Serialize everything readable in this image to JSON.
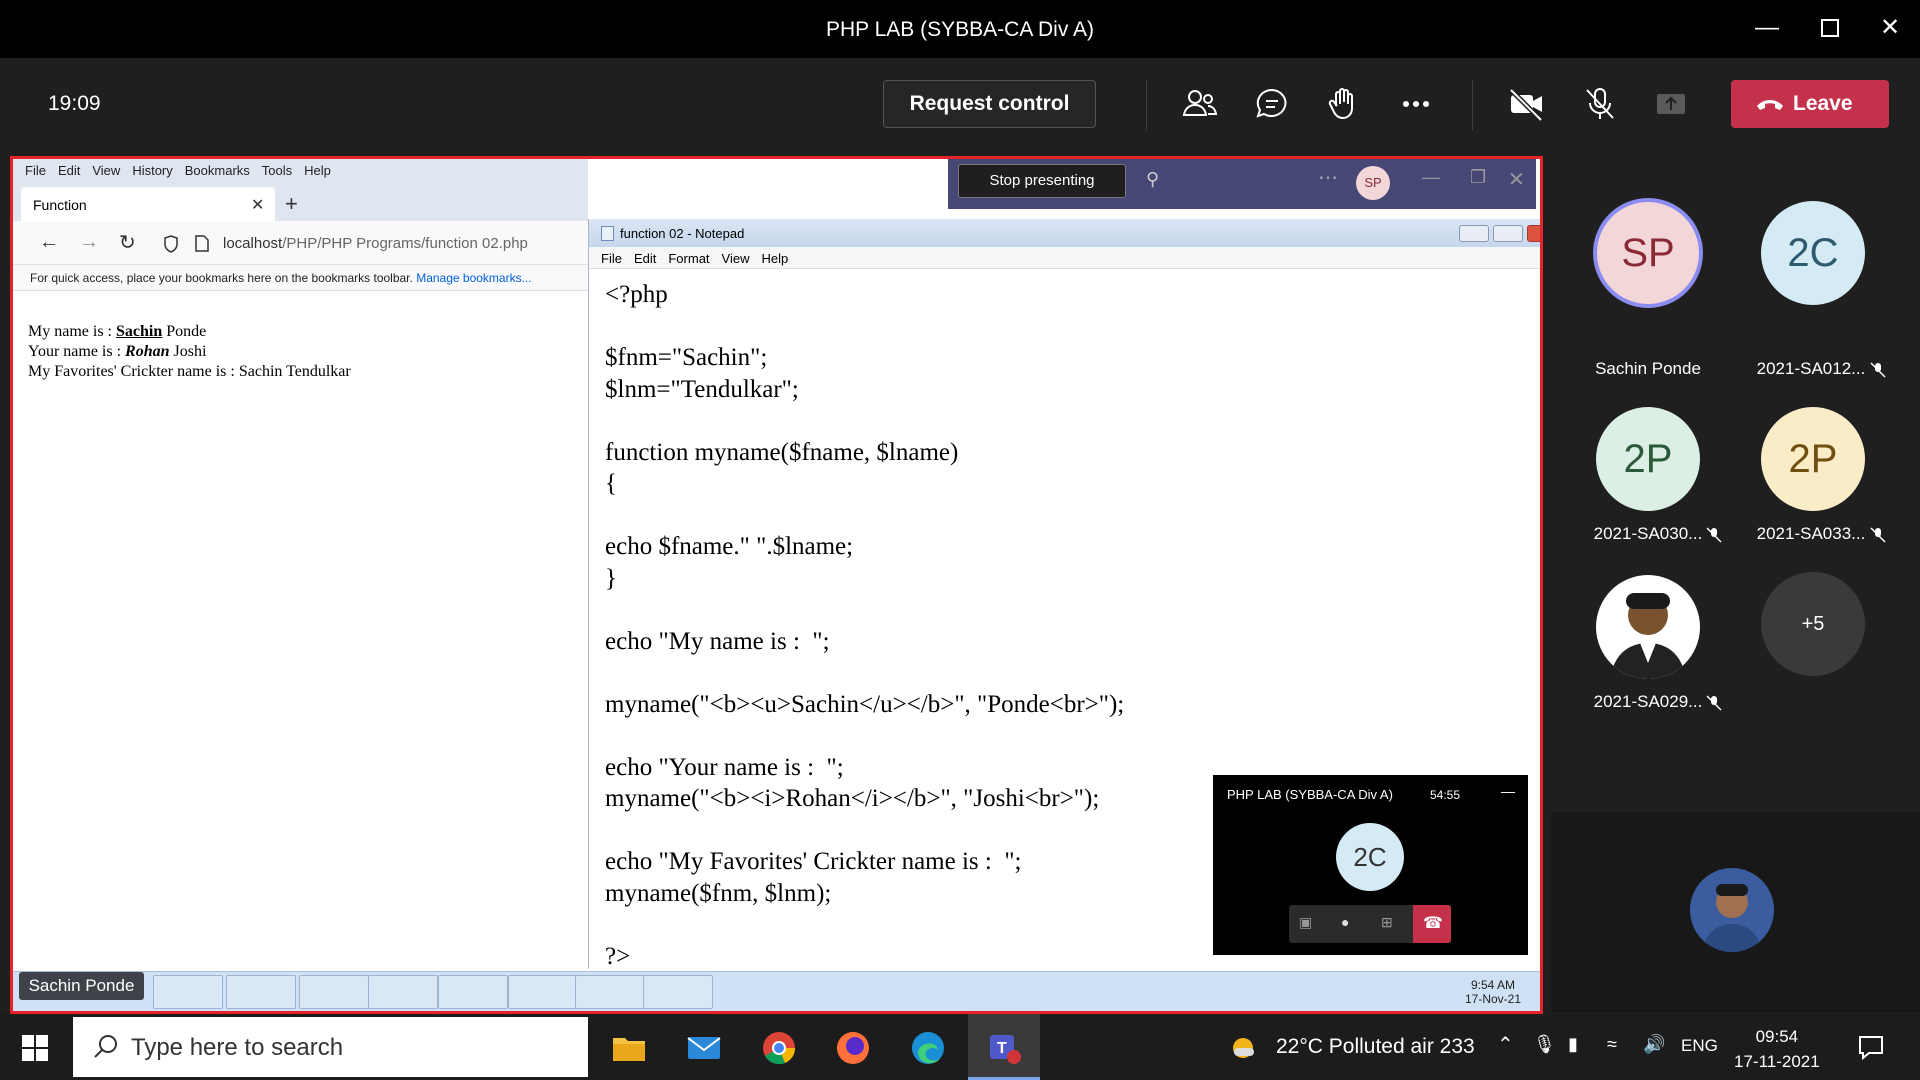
{
  "window": {
    "title": "PHP LAB (SYBBA-CA Div A)",
    "minimize_icon": "minimize-icon",
    "maximize_icon": "maximize-icon",
    "close_icon": "close-icon"
  },
  "toolbar": {
    "time": "19:09",
    "request_control": "Request control",
    "icons": [
      "people-icon",
      "chat-icon",
      "raise-hand-icon",
      "more-icon",
      "camera-off-icon",
      "mic-off-icon",
      "share-tray-icon"
    ],
    "leave": "Leave",
    "leave_color": "#c4314b"
  },
  "shared_screen": {
    "firefox": {
      "menu": [
        "File",
        "Edit",
        "View",
        "History",
        "Bookmarks",
        "Tools",
        "Help"
      ],
      "tab_title": "Function",
      "url_host": "localhost",
      "url_path": "/PHP/PHP Programs/function 02.php",
      "bookmarks_hint": "For quick access, place your bookmarks here on the bookmarks toolbar.",
      "bookmarks_link": "Manage bookmarks...",
      "lines": [
        {
          "prefix": "My name is : ",
          "bold": "Sachin",
          "suffix": " Ponde"
        },
        {
          "prefix": "Your name is : ",
          "bold": "Rohan",
          "suffix": " Joshi"
        },
        {
          "prefix": "My Favorites' Crickter name is : Sachin Tendulkar",
          "bold": "",
          "suffix": ""
        }
      ]
    },
    "present_bar": {
      "stop": "Stop presenting",
      "avatar": "SP"
    },
    "notepad": {
      "title": "function 02 - Notepad",
      "menu": [
        "File",
        "Edit",
        "Format",
        "View",
        "Help"
      ],
      "code": "<?php\n\n$fnm=\"Sachin\";\n$lnm=\"Tendulkar\";\n\nfunction myname($fname, $lname)\n{\n\necho $fname.\" \".$lname;\n}\n\necho \"My name is :  \";\n\nmyname(\"<b><u>Sachin</u></b>\", \"Ponde<br>\");\n\necho \"Your name is :  \";\nmyname(\"<b><i>Rohan</i></b>\", \"Joshi<br>\");\n\necho \"My Favorites' Crickter name is :  \";\nmyname($fnm, $lnm);\n\n?>"
    },
    "mini_window": {
      "title": "PHP LAB (SYBBA-CA Div A)",
      "time": "54:55",
      "avatar": "2C"
    },
    "taskbar": {
      "presenter": "Sachin Ponde",
      "time": "9:54 AM",
      "date": "17-Nov-21"
    }
  },
  "participants": [
    {
      "initials": "SP",
      "name": "Sachin Ponde",
      "bg": "#f3d6d8",
      "fg": "#8a2a35",
      "muted": false,
      "speaking": true
    },
    {
      "initials": "2C",
      "name": "2021-SA012...",
      "bg": "#d4eaf4",
      "fg": "#2d5a6e",
      "muted": true
    },
    {
      "initials": "2P",
      "name": "2021-SA030...",
      "bg": "#dcefe4",
      "fg": "#2a5a3a",
      "muted": true
    },
    {
      "initials": "2P",
      "name": "2021-SA033...",
      "bg": "#fbecc8",
      "fg": "#6e4f10",
      "muted": true
    },
    {
      "initials": "",
      "name": "2021-SA029...",
      "bg": "#ffffff",
      "fg": "#333",
      "muted": true
    },
    {
      "initials": "+5",
      "name": "",
      "bg": "#3a3a3a",
      "fg": "#ffffff",
      "muted": false
    }
  ],
  "windows_taskbar": {
    "search_placeholder": "Type here to search",
    "weather": "22°C  Polluted air 233",
    "lang": "ENG",
    "time": "09:54",
    "date": "17-11-2021"
  }
}
